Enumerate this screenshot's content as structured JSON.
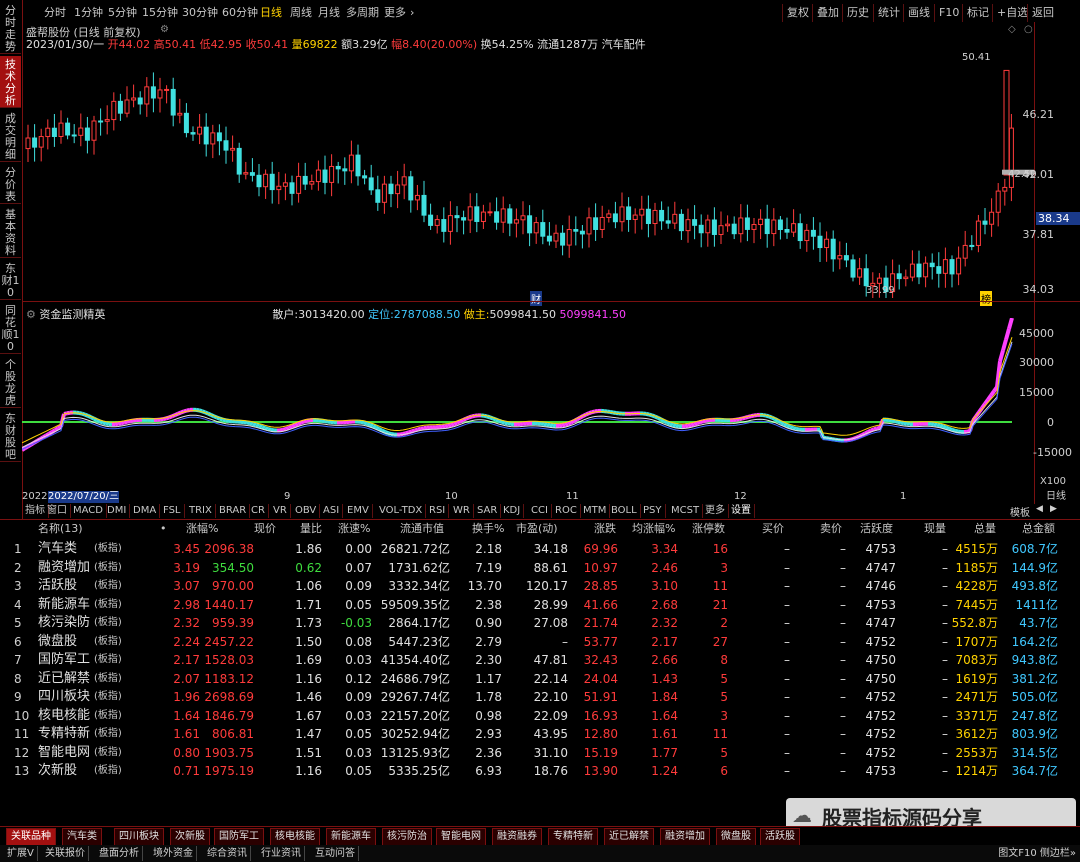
{
  "left_tabs": [
    "分时走势",
    "技术分析",
    "成交明细",
    "分价表",
    "基本资料",
    "东财10",
    "同花顺10",
    "个股龙虎",
    "东财股吧"
  ],
  "toolbar": {
    "periods": [
      "分时",
      "1分钟",
      "5分钟",
      "15分钟",
      "30分钟",
      "60分钟",
      "日线",
      "周线",
      "月线",
      "多周期",
      "更多"
    ],
    "active_period": "日线",
    "right": [
      "复权",
      "叠加",
      "历史",
      "统计",
      "画线",
      "F10",
      "标记",
      "+自选",
      "返回"
    ]
  },
  "stock": {
    "name_line": "盛帮股份 (日线 前复权)",
    "date": "2023/01/30/一",
    "open_label": "开",
    "open": "44.02",
    "high_label": "高",
    "high": "50.41",
    "low_label": "低",
    "low": "42.95",
    "close_label": "收",
    "close": "50.41",
    "vol_label": "量",
    "vol": "69822",
    "amount_label": "额",
    "amount": "3.29亿",
    "range_label": "幅",
    "range": "8.40(20.00%)",
    "turnover": "换54.25%",
    "float": "流通1287万",
    "sector": "汽车配件"
  },
  "price_axis": {
    "labels": [
      "46.21",
      "42.01",
      "37.81",
      "34.03"
    ],
    "current": "38.34",
    "peak": "50.41",
    "mark_low": "33.99",
    "mark_now": "42.50"
  },
  "event_markers": [
    "财",
    "榜"
  ],
  "indicator": {
    "name": "资金监测精英",
    "line1_label": "散户:",
    "line1": "3013420.00",
    "line2_label": "定位:",
    "line2": "2787088.50",
    "line3_label": "做主:",
    "line3": "5099841.50",
    "line4": "5099841.50",
    "axis": [
      "45000",
      "30000",
      "15000",
      "0",
      "-15000"
    ],
    "scale": "X100"
  },
  "date_axis": [
    "2022",
    "2022/07/20/三",
    "9",
    "10",
    "11",
    "12",
    "1",
    "日线"
  ],
  "indicator_tabs": [
    "指标",
    "窗口",
    "MACD",
    "DMI",
    "DMA",
    "FSL",
    "TRIX",
    "BRAR",
    "CR",
    "VR",
    "OBV",
    "ASI",
    "EMV",
    "VOL-TDX",
    "RSI",
    "WR",
    "SAR",
    "KDJ",
    "CCI",
    "ROC",
    "MTM",
    "BOLL",
    "PSY",
    "MCST",
    "更多",
    "设置"
  ],
  "template_label": "模板",
  "table": {
    "headers": [
      "名称(13)",
      "•",
      "涨幅%",
      "现价",
      "量比",
      "涨速%",
      "流通市值",
      "换手%",
      "市盈(动)",
      "涨跌",
      "均涨幅%",
      "涨停数",
      "买价",
      "卖价",
      "活跃度",
      "现量",
      "总量",
      "总金额"
    ],
    "rows": [
      [
        "1",
        "汽车类",
        "(板指)",
        "3.45",
        "2096.38",
        "1.86",
        "0.00",
        "26821.72亿",
        "2.18",
        "34.18",
        "69.96",
        "3.34",
        "16",
        "–",
        "–",
        "4753",
        "–",
        "4515万",
        "608.7亿"
      ],
      [
        "2",
        "融资增加",
        "(板指)",
        "3.19",
        "354.50",
        "0.62",
        "0.07",
        "1731.62亿",
        "7.19",
        "88.61",
        "10.97",
        "2.46",
        "3",
        "–",
        "–",
        "4747",
        "–",
        "1185万",
        "144.9亿"
      ],
      [
        "3",
        "活跃股",
        "(板指)",
        "3.07",
        "970.00",
        "1.06",
        "0.09",
        "3332.34亿",
        "13.70",
        "120.17",
        "28.85",
        "3.10",
        "11",
        "–",
        "–",
        "4746",
        "–",
        "4228万",
        "493.8亿"
      ],
      [
        "4",
        "新能源车",
        "(板指)",
        "2.98",
        "1440.17",
        "1.71",
        "0.05",
        "59509.35亿",
        "2.38",
        "28.99",
        "41.66",
        "2.68",
        "21",
        "–",
        "–",
        "4753",
        "–",
        "7445万",
        "1411亿"
      ],
      [
        "5",
        "核污染防",
        "(板指)",
        "2.32",
        "959.39",
        "1.73",
        "-0.03",
        "2864.17亿",
        "0.90",
        "27.08",
        "21.74",
        "2.32",
        "2",
        "–",
        "–",
        "4747",
        "–",
        "552.8万",
        "43.7亿"
      ],
      [
        "6",
        "微盘股",
        "(板指)",
        "2.24",
        "2457.22",
        "1.50",
        "0.08",
        "5447.23亿",
        "2.79",
        "–",
        "53.77",
        "2.17",
        "27",
        "–",
        "–",
        "4752",
        "–",
        "1707万",
        "164.2亿"
      ],
      [
        "7",
        "国防军工",
        "(板指)",
        "2.17",
        "1528.03",
        "1.69",
        "0.03",
        "41354.40亿",
        "2.30",
        "47.81",
        "32.43",
        "2.66",
        "8",
        "–",
        "–",
        "4750",
        "–",
        "7083万",
        "943.8亿"
      ],
      [
        "8",
        "近已解禁",
        "(板指)",
        "2.07",
        "1183.12",
        "1.16",
        "0.12",
        "24686.79亿",
        "1.17",
        "22.14",
        "24.04",
        "1.43",
        "5",
        "–",
        "–",
        "4750",
        "–",
        "1619万",
        "381.2亿"
      ],
      [
        "9",
        "四川板块",
        "(板指)",
        "1.96",
        "2698.69",
        "1.46",
        "0.09",
        "29267.74亿",
        "1.78",
        "22.10",
        "51.91",
        "1.84",
        "5",
        "–",
        "–",
        "4752",
        "–",
        "2471万",
        "505.0亿"
      ],
      [
        "10",
        "核电核能",
        "(板指)",
        "1.64",
        "1846.79",
        "1.67",
        "0.03",
        "22157.20亿",
        "0.98",
        "22.09",
        "16.93",
        "1.64",
        "3",
        "–",
        "–",
        "4752",
        "–",
        "3371万",
        "247.8亿"
      ],
      [
        "11",
        "专精特新",
        "(板指)",
        "1.61",
        "806.81",
        "1.47",
        "0.05",
        "30252.94亿",
        "2.93",
        "43.95",
        "12.80",
        "1.61",
        "11",
        "–",
        "–",
        "4752",
        "–",
        "3612万",
        "803.9亿"
      ],
      [
        "12",
        "智能电网",
        "(板指)",
        "0.80",
        "1903.75",
        "1.51",
        "0.03",
        "13125.93亿",
        "2.36",
        "31.10",
        "15.19",
        "1.77",
        "5",
        "–",
        "–",
        "4752",
        "–",
        "2553万",
        "314.5亿"
      ],
      [
        "13",
        "次新股",
        "(板指)",
        "0.71",
        "1975.19",
        "1.16",
        "0.05",
        "5335.25亿",
        "6.93",
        "18.76",
        "13.90",
        "1.24",
        "6",
        "–",
        "–",
        "4753",
        "–",
        "1214万",
        "364.7亿"
      ]
    ]
  },
  "footer_tabs": [
    "关联品种",
    "汽车类",
    "四川板块",
    "次新股",
    "国防军工",
    "核电核能",
    "新能源车",
    "核污防治",
    "智能电网",
    "融资融券",
    "专精特新",
    "近已解禁",
    "融资增加",
    "微盘股",
    "活跃股"
  ],
  "footer2": [
    "扩展V",
    "关联报价",
    "盘面分析",
    "境外资金",
    "综合资讯",
    "行业资讯",
    "互动问答"
  ],
  "footer2_right": "图文F10 侧边栏»",
  "watermark": "股票指标源码分享",
  "colors": {
    "up": "#ff3b3b",
    "down": "#40e0e0",
    "accent": "#ffd200",
    "volume": "#ffd200",
    "border": "#7a1010"
  }
}
